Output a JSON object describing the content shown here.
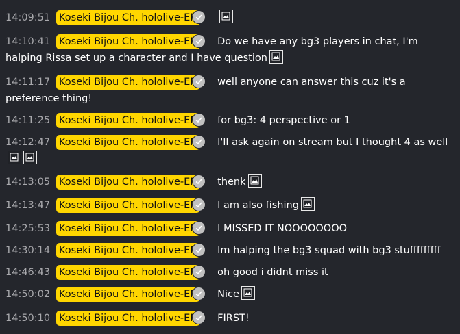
{
  "messages": [
    {
      "time": "14:09:51",
      "author": "Koseki Bijou Ch. hololive-EN",
      "text": "",
      "emotes": 1
    },
    {
      "time": "14:10:41",
      "author": "Koseki Bijou Ch. hololive-EN",
      "text": "Do we have any bg3 players in chat, I'm halping Rissa set up a character and I have question",
      "emotes": 1
    },
    {
      "time": "14:11:17",
      "author": "Koseki Bijou Ch. hololive-EN",
      "text": "well anyone can answer this cuz it's a preference thing!",
      "emotes": 0
    },
    {
      "time": "14:11:25",
      "author": "Koseki Bijou Ch. hololive-EN",
      "text": "for bg3: 4 perspective or 1",
      "emotes": 0
    },
    {
      "time": "14:12:47",
      "author": "Koseki Bijou Ch. hololive-EN",
      "text": "I'll ask again on stream but I thought 4 as well",
      "emotes": 2
    },
    {
      "time": "14:13:05",
      "author": "Koseki Bijou Ch. hololive-EN",
      "text": "thenk",
      "emotes": 1
    },
    {
      "time": "14:13:47",
      "author": "Koseki Bijou Ch. hololive-EN",
      "text": "I am also fishing",
      "emotes": 1
    },
    {
      "time": "14:25:53",
      "author": "Koseki Bijou Ch. hololive-EN",
      "text": "I MISSED IT NOOOOOOOO",
      "emotes": 0
    },
    {
      "time": "14:30:14",
      "author": "Koseki Bijou Ch. hololive-EN",
      "text": "Im halping the bg3 squad with bg3 stufffffffff",
      "emotes": 0
    },
    {
      "time": "14:46:43",
      "author": "Koseki Bijou Ch. hololive-EN",
      "text": "oh good i didnt miss it",
      "emotes": 0
    },
    {
      "time": "14:50:02",
      "author": "Koseki Bijou Ch. hololive-EN",
      "text": "Nice",
      "emotes": 1
    },
    {
      "time": "14:50:10",
      "author": "Koseki Bijou Ch. hololive-EN",
      "text": "FIRST!",
      "emotes": 0
    }
  ],
  "badge_icon": "verified-check-icon",
  "emote_icon": "broken-image-icon",
  "colors": {
    "background": "#24262c",
    "name_highlight": "#ffd600",
    "timestamp": "#a9a9ad",
    "text": "#ffffff"
  }
}
